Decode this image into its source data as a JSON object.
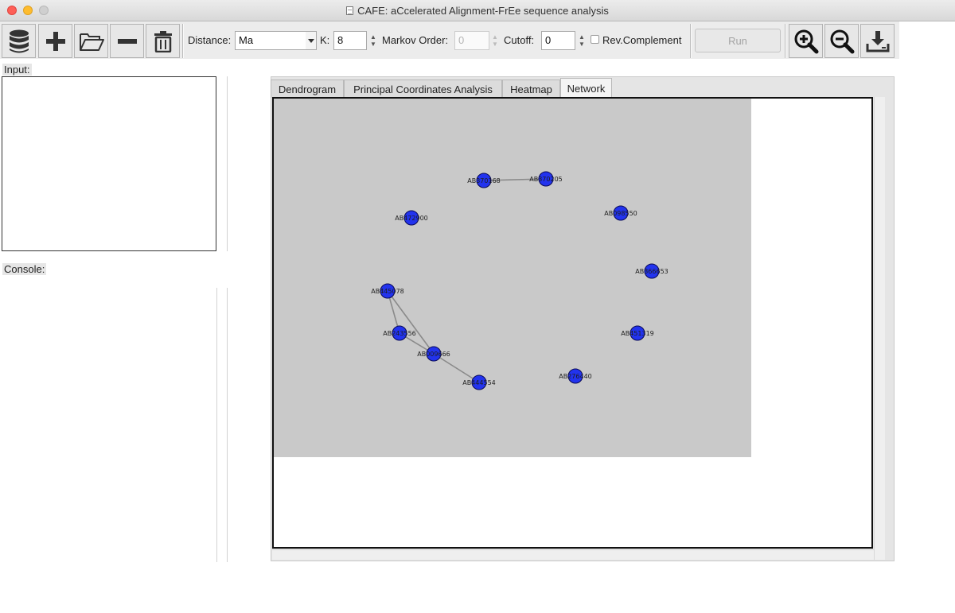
{
  "window": {
    "title": "CAFE: aCcelerated Alignment-FrEe sequence analysis"
  },
  "toolbar": {
    "icons": [
      "database-icon",
      "plus-icon",
      "folder-open-icon",
      "minus-icon",
      "trash-icon",
      "zoom-in-icon",
      "zoom-out-icon",
      "download-icon"
    ],
    "distance_label": "Distance:",
    "distance_value": "Ma",
    "k_label": "K:",
    "k_value": "8",
    "markov_label": "Markov Order:",
    "markov_value": "0",
    "cutoff_label": "Cutoff:",
    "cutoff_value": "0",
    "revcomp_label": "Rev.Complement",
    "revcomp_checked": false,
    "run_label": "Run"
  },
  "left": {
    "input_label": "Input:",
    "console_label": "Console:"
  },
  "tabs": [
    {
      "label": "Dendrogram",
      "active": false
    },
    {
      "label": "Principal Coordinates Analysis",
      "active": false
    },
    {
      "label": "Heatmap",
      "active": false
    },
    {
      "label": "Network",
      "active": true
    }
  ],
  "network": {
    "background": "#c9c9c9",
    "node_color": "#2233ee",
    "edge_color": "#8a8a8a",
    "nodes": [
      "AB370168",
      "AB370205",
      "AB472900",
      "AB098550",
      "AB366653",
      "AB445078",
      "AB243556",
      "AB451319",
      "AB009666",
      "AB276440",
      "AB444554"
    ],
    "edges": [
      [
        "AB370168",
        "AB370205"
      ],
      [
        "AB445078",
        "AB243556"
      ],
      [
        "AB445078",
        "AB009666"
      ],
      [
        "AB243556",
        "AB009666"
      ],
      [
        "AB009666",
        "AB444554"
      ]
    ]
  }
}
